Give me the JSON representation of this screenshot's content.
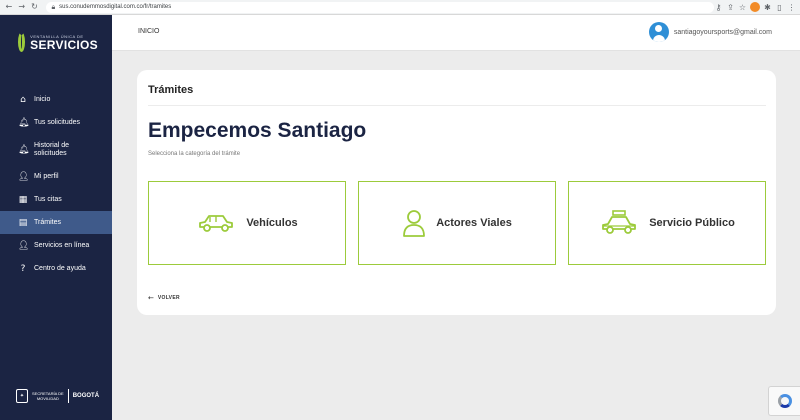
{
  "browser": {
    "url": "sus.conudemmosdigital.com.co/fr/tramites",
    "back_icon": "arrow-left-icon",
    "forward_icon": "arrow-right-icon",
    "reload_icon": "reload-icon"
  },
  "sidebar": {
    "logo": {
      "small": "VENTANILLA ÚNICA DE",
      "big": "SERVICIOS",
      "accent": "#9ccb3b"
    },
    "items": [
      {
        "label": "Inicio",
        "icon": "home-icon",
        "active": false
      },
      {
        "label": "Tus solicitudes",
        "icon": "bell-icon",
        "active": false
      },
      {
        "label": "Historial de solicitudes",
        "icon": "bell-icon",
        "active": false
      },
      {
        "label": "Mi perfil",
        "icon": "user-icon",
        "active": false
      },
      {
        "label": "Tus citas",
        "icon": "calendar-icon",
        "active": false
      },
      {
        "label": "Trámites",
        "icon": "document-icon",
        "active": true
      },
      {
        "label": "Servicios en línea",
        "icon": "user-icon",
        "active": false
      },
      {
        "label": "Centro de ayuda",
        "icon": "help-icon",
        "active": false
      }
    ],
    "footer": {
      "mov_line1": "SECRETARÍA DE",
      "mov_line2": "MOVILIDAD",
      "bogota": "BOGOTÁ"
    },
    "bg_color": "#1b2443",
    "active_color": "#3f5a8a"
  },
  "topbar": {
    "breadcrumb": "INICIO",
    "user_email": "santiagoyoursports@gmail.com",
    "avatar_color": "#2f8fd6"
  },
  "main": {
    "card_title": "Trámites",
    "heading": "Empecemos Santiago",
    "subheading": "Selecciona la categoría del trámite",
    "options": [
      {
        "label": "Vehículos",
        "icon": "car-icon"
      },
      {
        "label": "Actores Viales",
        "icon": "person-icon"
      },
      {
        "label": "Servicio Público",
        "icon": "taxi-icon"
      }
    ],
    "back_label": "VOLVER",
    "border_color": "#9ccb3b"
  }
}
